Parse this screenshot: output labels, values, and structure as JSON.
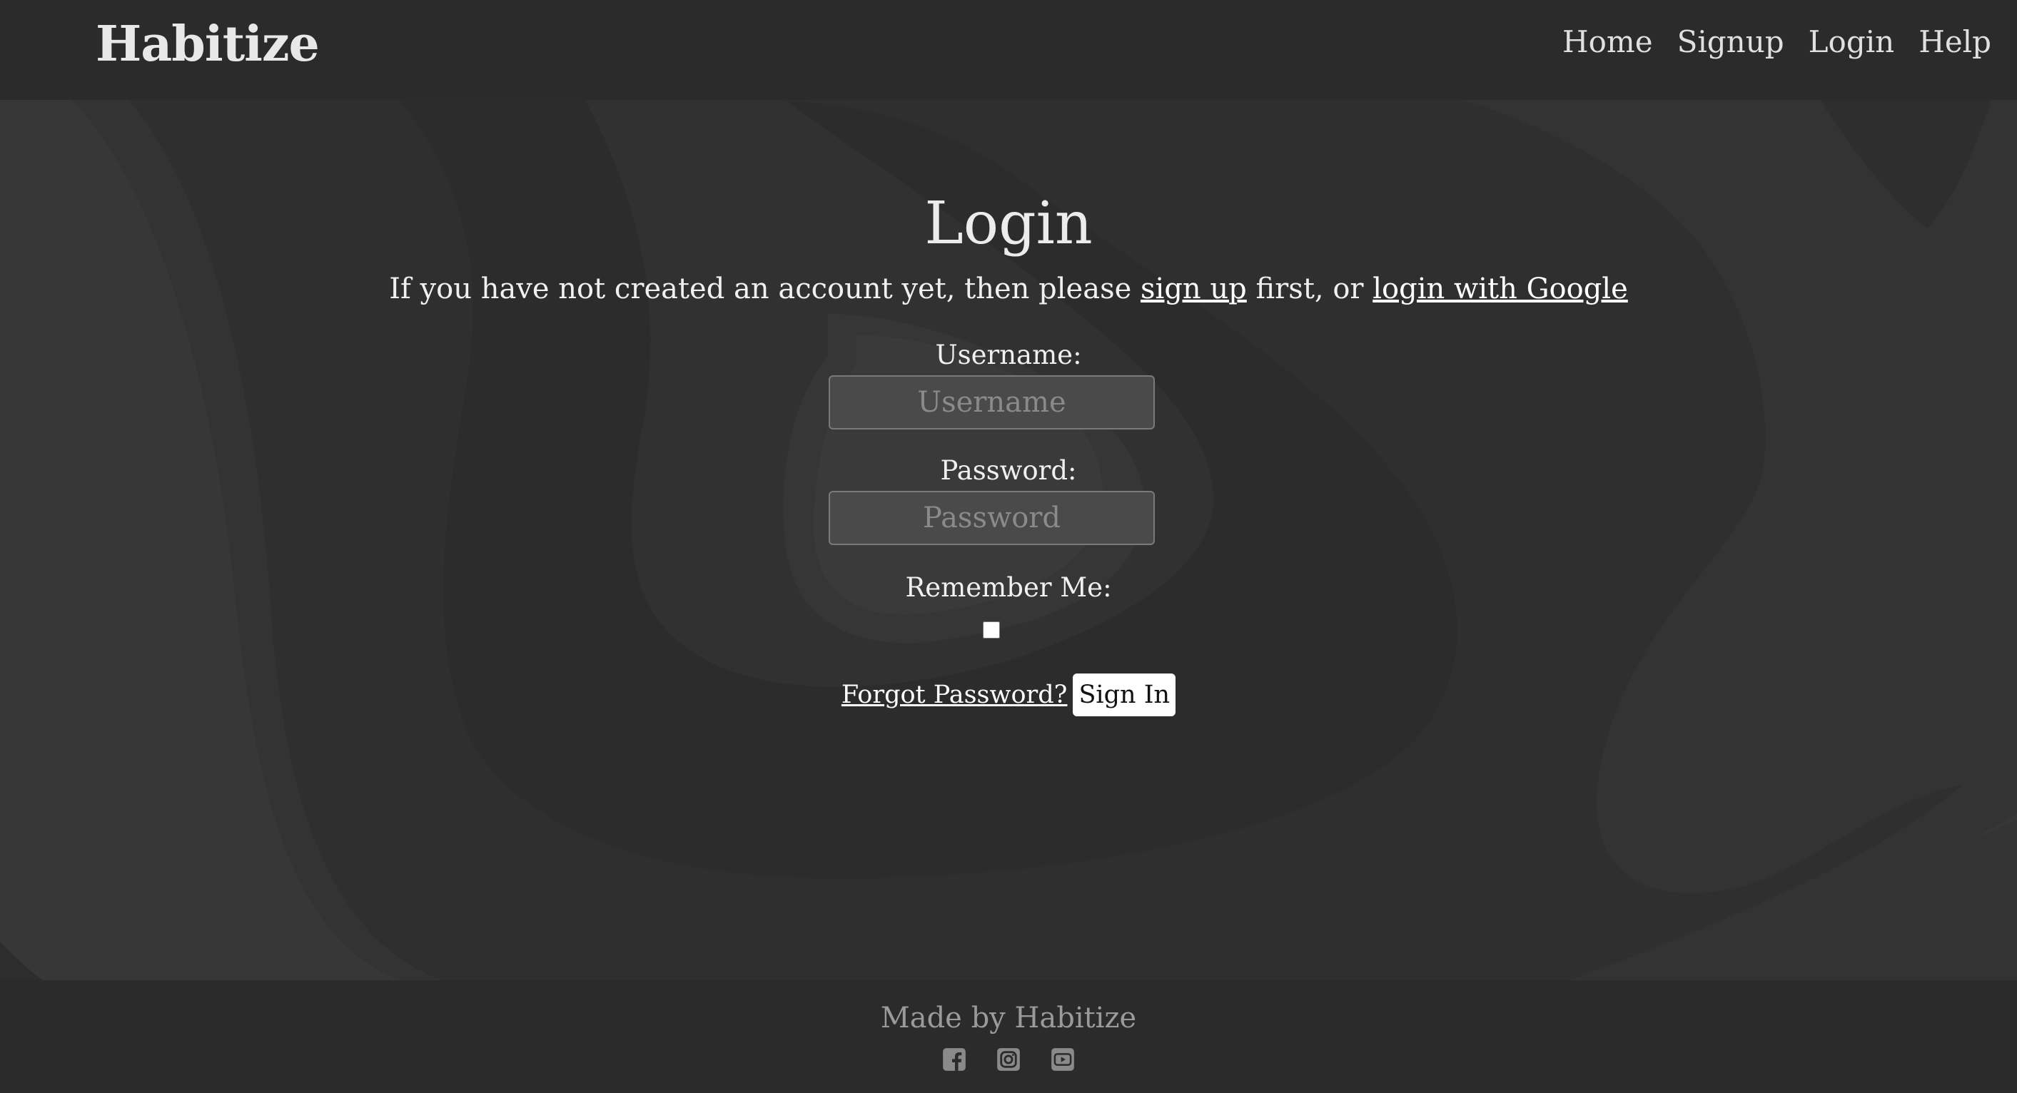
{
  "navbar": {
    "brand": "Habitize",
    "links": [
      "Home",
      "Signup",
      "Login",
      "Help"
    ]
  },
  "main": {
    "title": "Login",
    "intro": {
      "before": "If you have not created an account yet, then please ",
      "signup_link": "sign up",
      "middle": " first, or ",
      "google_link": "login with Google"
    },
    "username": {
      "label": "Username:",
      "placeholder": "Username",
      "value": ""
    },
    "password": {
      "label": "Password:",
      "placeholder": "Password",
      "value": ""
    },
    "remember": {
      "label": "Remember Me:",
      "checked": false
    },
    "forgot_link": "Forgot Password?",
    "signin_label": "Sign In"
  },
  "footer": {
    "text": "Made by Habitize",
    "icons": [
      "facebook-icon",
      "instagram-icon",
      "youtube-icon"
    ]
  },
  "colors": {
    "background": "#2b2b2b",
    "hero": "#363636",
    "text": "#e6e6e6",
    "footer_text": "#9a9a9a"
  }
}
